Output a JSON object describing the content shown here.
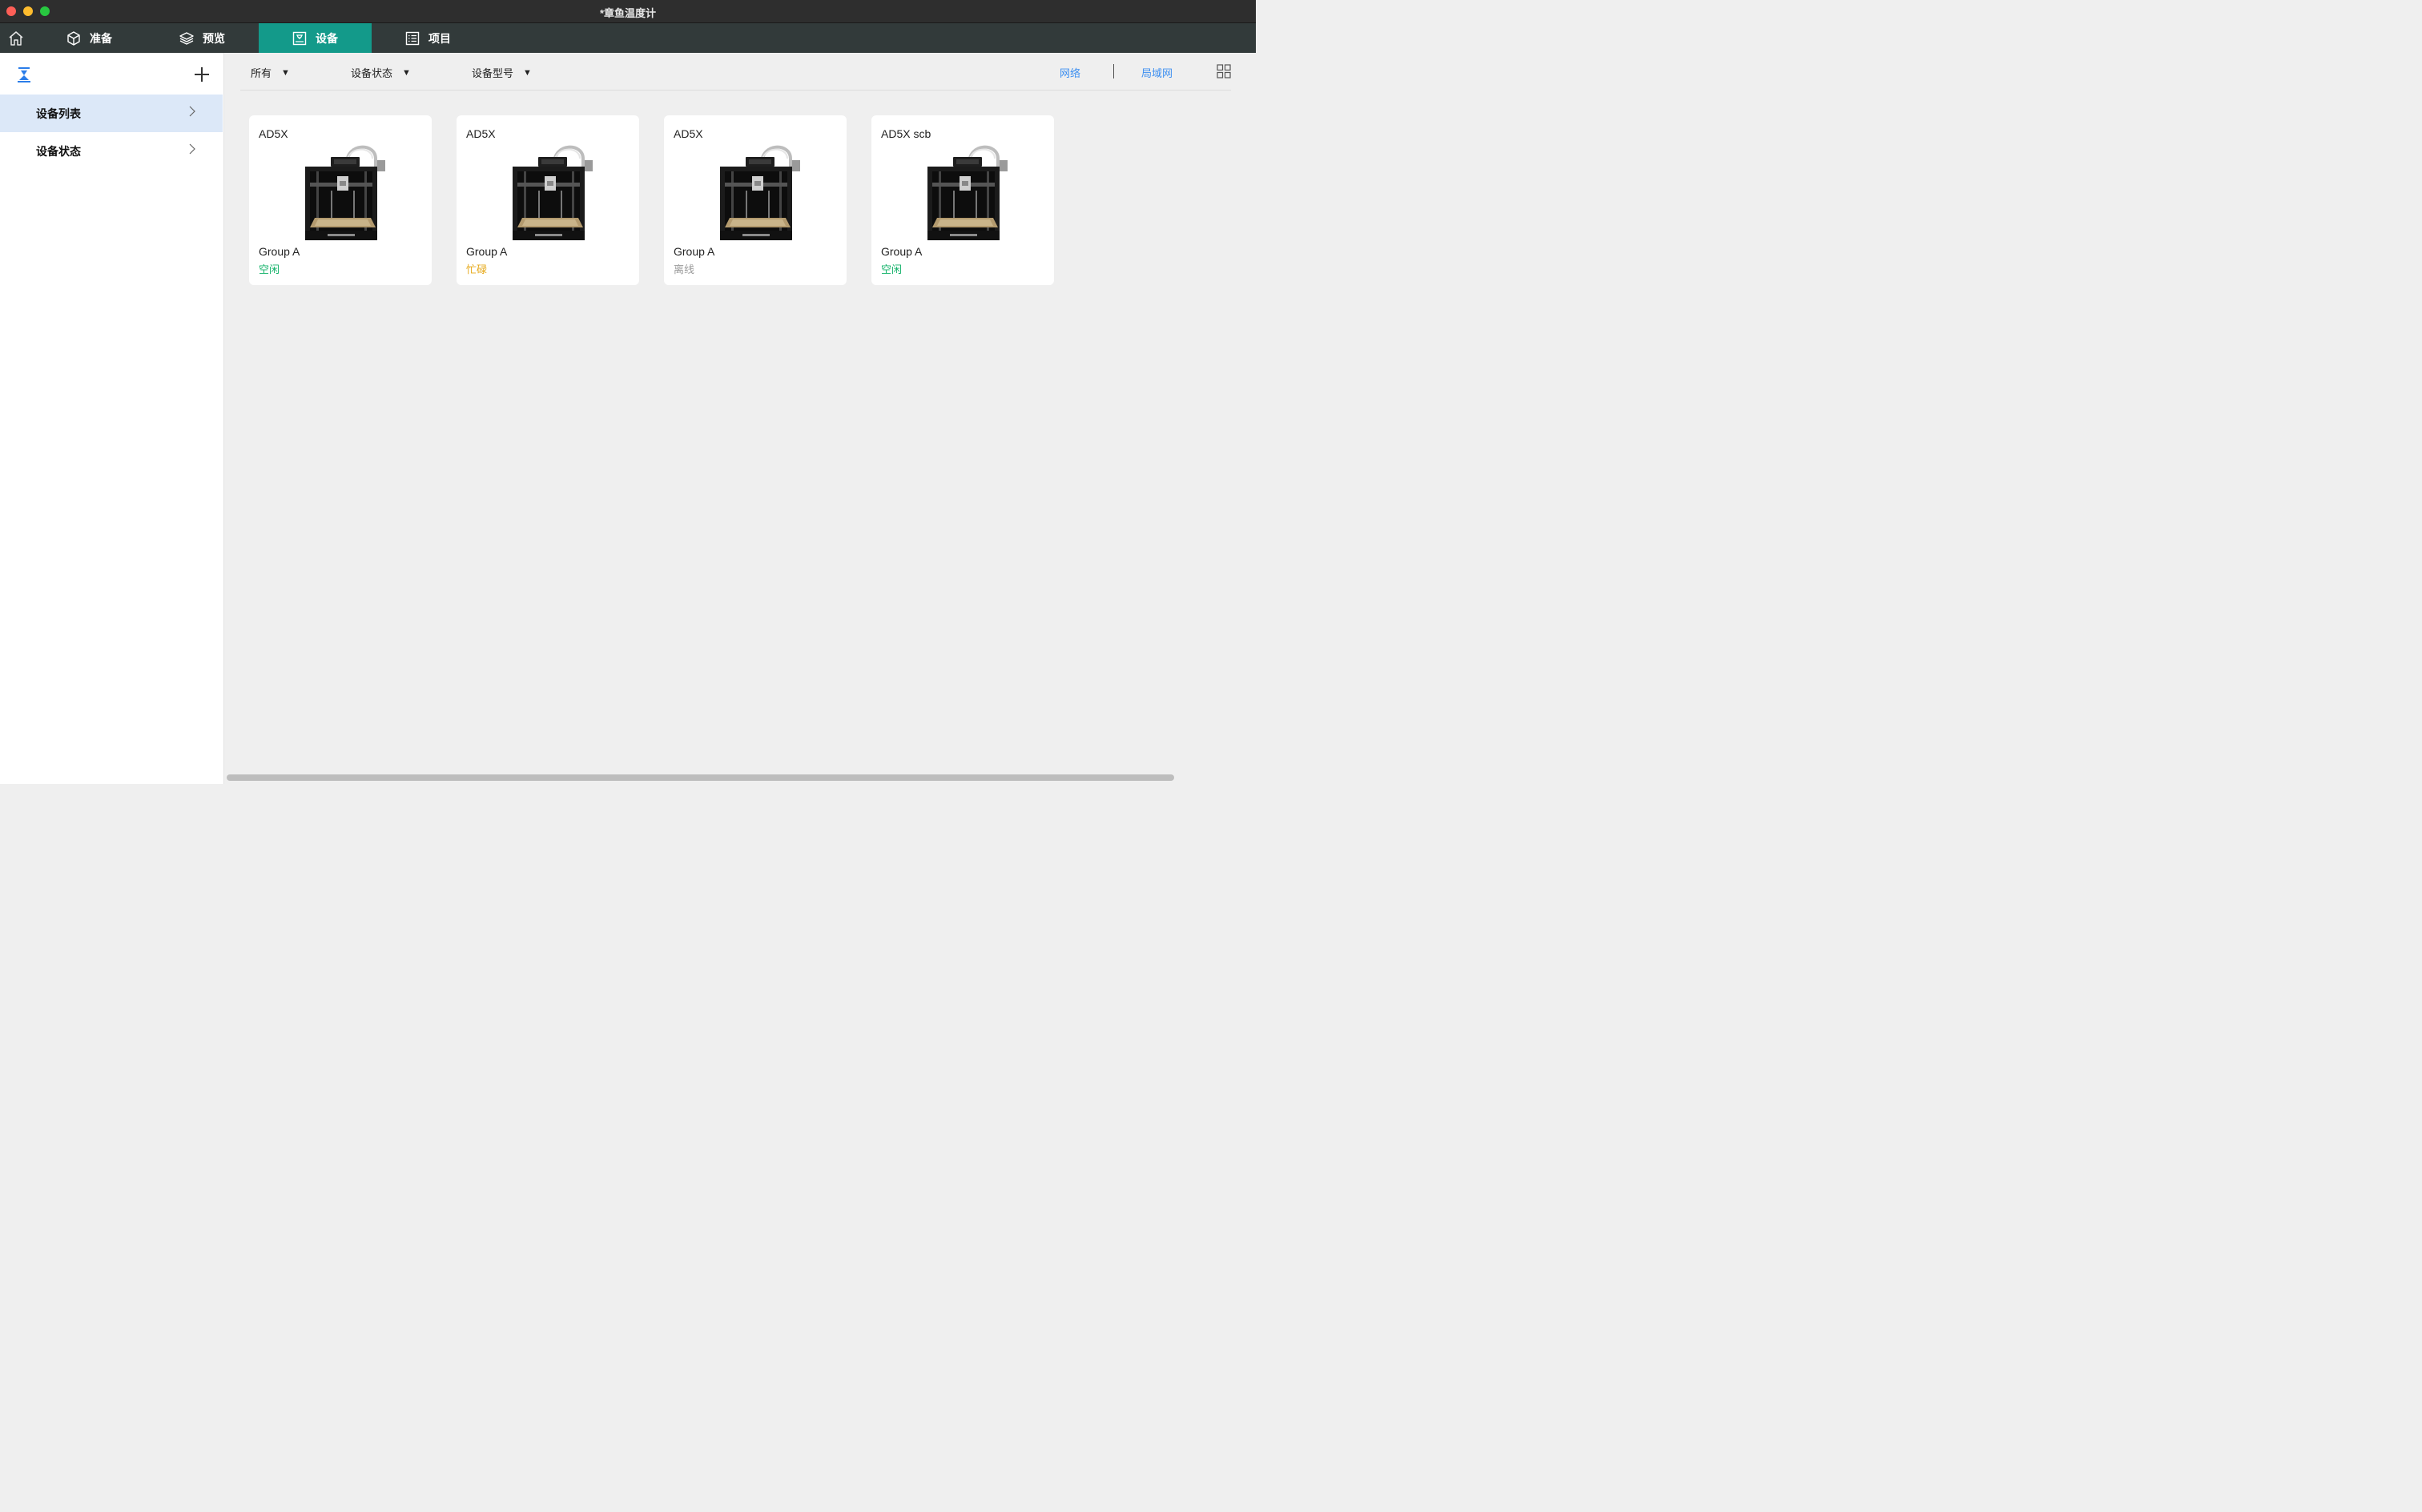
{
  "window": {
    "title": "*章鱼温度计"
  },
  "topnav": {
    "home_icon": "home-icon",
    "tabs": [
      {
        "label": "准备",
        "icon": "cube-icon"
      },
      {
        "label": "预览",
        "icon": "layers-icon"
      },
      {
        "label": "设备",
        "icon": "device-icon",
        "active": true
      },
      {
        "label": "项目",
        "icon": "list-icon"
      }
    ]
  },
  "sidebar": {
    "logo_icon": "printer-logo-icon",
    "add_icon": "plus-icon",
    "items": [
      {
        "label": "设备列表",
        "selected": true
      },
      {
        "label": "设备状态",
        "selected": false
      }
    ]
  },
  "filters": {
    "all": "所有",
    "status": "设备状态",
    "model": "设备型号",
    "caret": "▼",
    "network": "网络",
    "lan": "局域网",
    "grid_icon": "grid-view-icon"
  },
  "devices": [
    {
      "name": "AD5X",
      "group": "Group A",
      "status": "空闲",
      "status_color": "#16b36b"
    },
    {
      "name": "AD5X",
      "group": "Group A",
      "status": "忙碌",
      "status_color": "#e6a817"
    },
    {
      "name": "AD5X",
      "group": "Group A",
      "status": "离线",
      "status_color": "#9a9a9a"
    },
    {
      "name": "AD5X scb",
      "group": "Group A",
      "status": "空闲",
      "status_color": "#16b36b"
    }
  ],
  "colors": {
    "accent": "#139a8a",
    "link": "#3d8ff0",
    "selected_bg": "#dce8f8"
  }
}
